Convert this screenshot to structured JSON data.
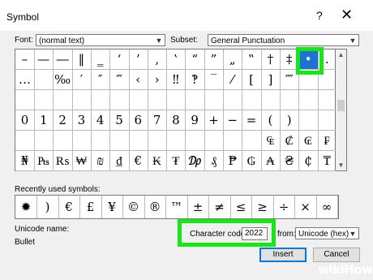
{
  "window": {
    "title": "Symbol",
    "help": "?",
    "close": "✕"
  },
  "font": {
    "label": "Font:",
    "value": "(normal text)"
  },
  "subset": {
    "label": "Subset:",
    "value": "General Punctuation"
  },
  "symbols": [
    [
      "–",
      "—",
      "―",
      "‖",
      "‗",
      "‘",
      "’",
      "‚",
      "‛",
      "“",
      "”",
      "„",
      "‟",
      "†",
      "‡",
      "•",
      "."
    ],
    [
      "…",
      "",
      "‰",
      "′",
      "″",
      "‴",
      "‹",
      "›",
      "‼",
      "‽",
      "‾",
      "⁄",
      "[",
      "]",
      "⁗",
      "",
      ""
    ],
    [
      "",
      "",
      "",
      "",
      "",
      "",
      "",
      "",
      "",
      "",
      "",
      "",
      "",
      "",
      "",
      "",
      ""
    ],
    [
      "0",
      "1",
      "2",
      "3",
      "4",
      "5",
      "6",
      "7",
      "8",
      "9",
      "+",
      "−",
      "=",
      "(",
      ")",
      "",
      ""
    ],
    [
      "",
      "",
      "",
      "",
      "",
      "",
      "",
      "",
      "",
      "",
      "",
      "",
      "",
      "₠",
      "₡",
      "₢",
      "₣"
    ],
    [
      "₦",
      "₧",
      "₨",
      "₩",
      "₪",
      "₫",
      "€",
      "₭",
      "₮",
      "₯",
      "₰",
      "₱",
      "₲",
      "₳",
      "₴",
      "₵",
      "₸"
    ]
  ],
  "recent": {
    "label": "Recently used symbols:",
    "items": [
      "✹",
      ")",
      "€",
      "£",
      "¥",
      "©",
      "®",
      "™",
      "±",
      "≠",
      "≤",
      "≥",
      "÷",
      "×",
      "∞"
    ]
  },
  "unicode": {
    "label": "Unicode name:",
    "value": "Bullet"
  },
  "character_code": {
    "label": "Character code:",
    "value": "2022"
  },
  "from": {
    "label": "from:",
    "value": "Unicode (hex)"
  },
  "buttons": {
    "insert": "Insert",
    "cancel": "Cancel"
  },
  "watermark": "wikiHow"
}
